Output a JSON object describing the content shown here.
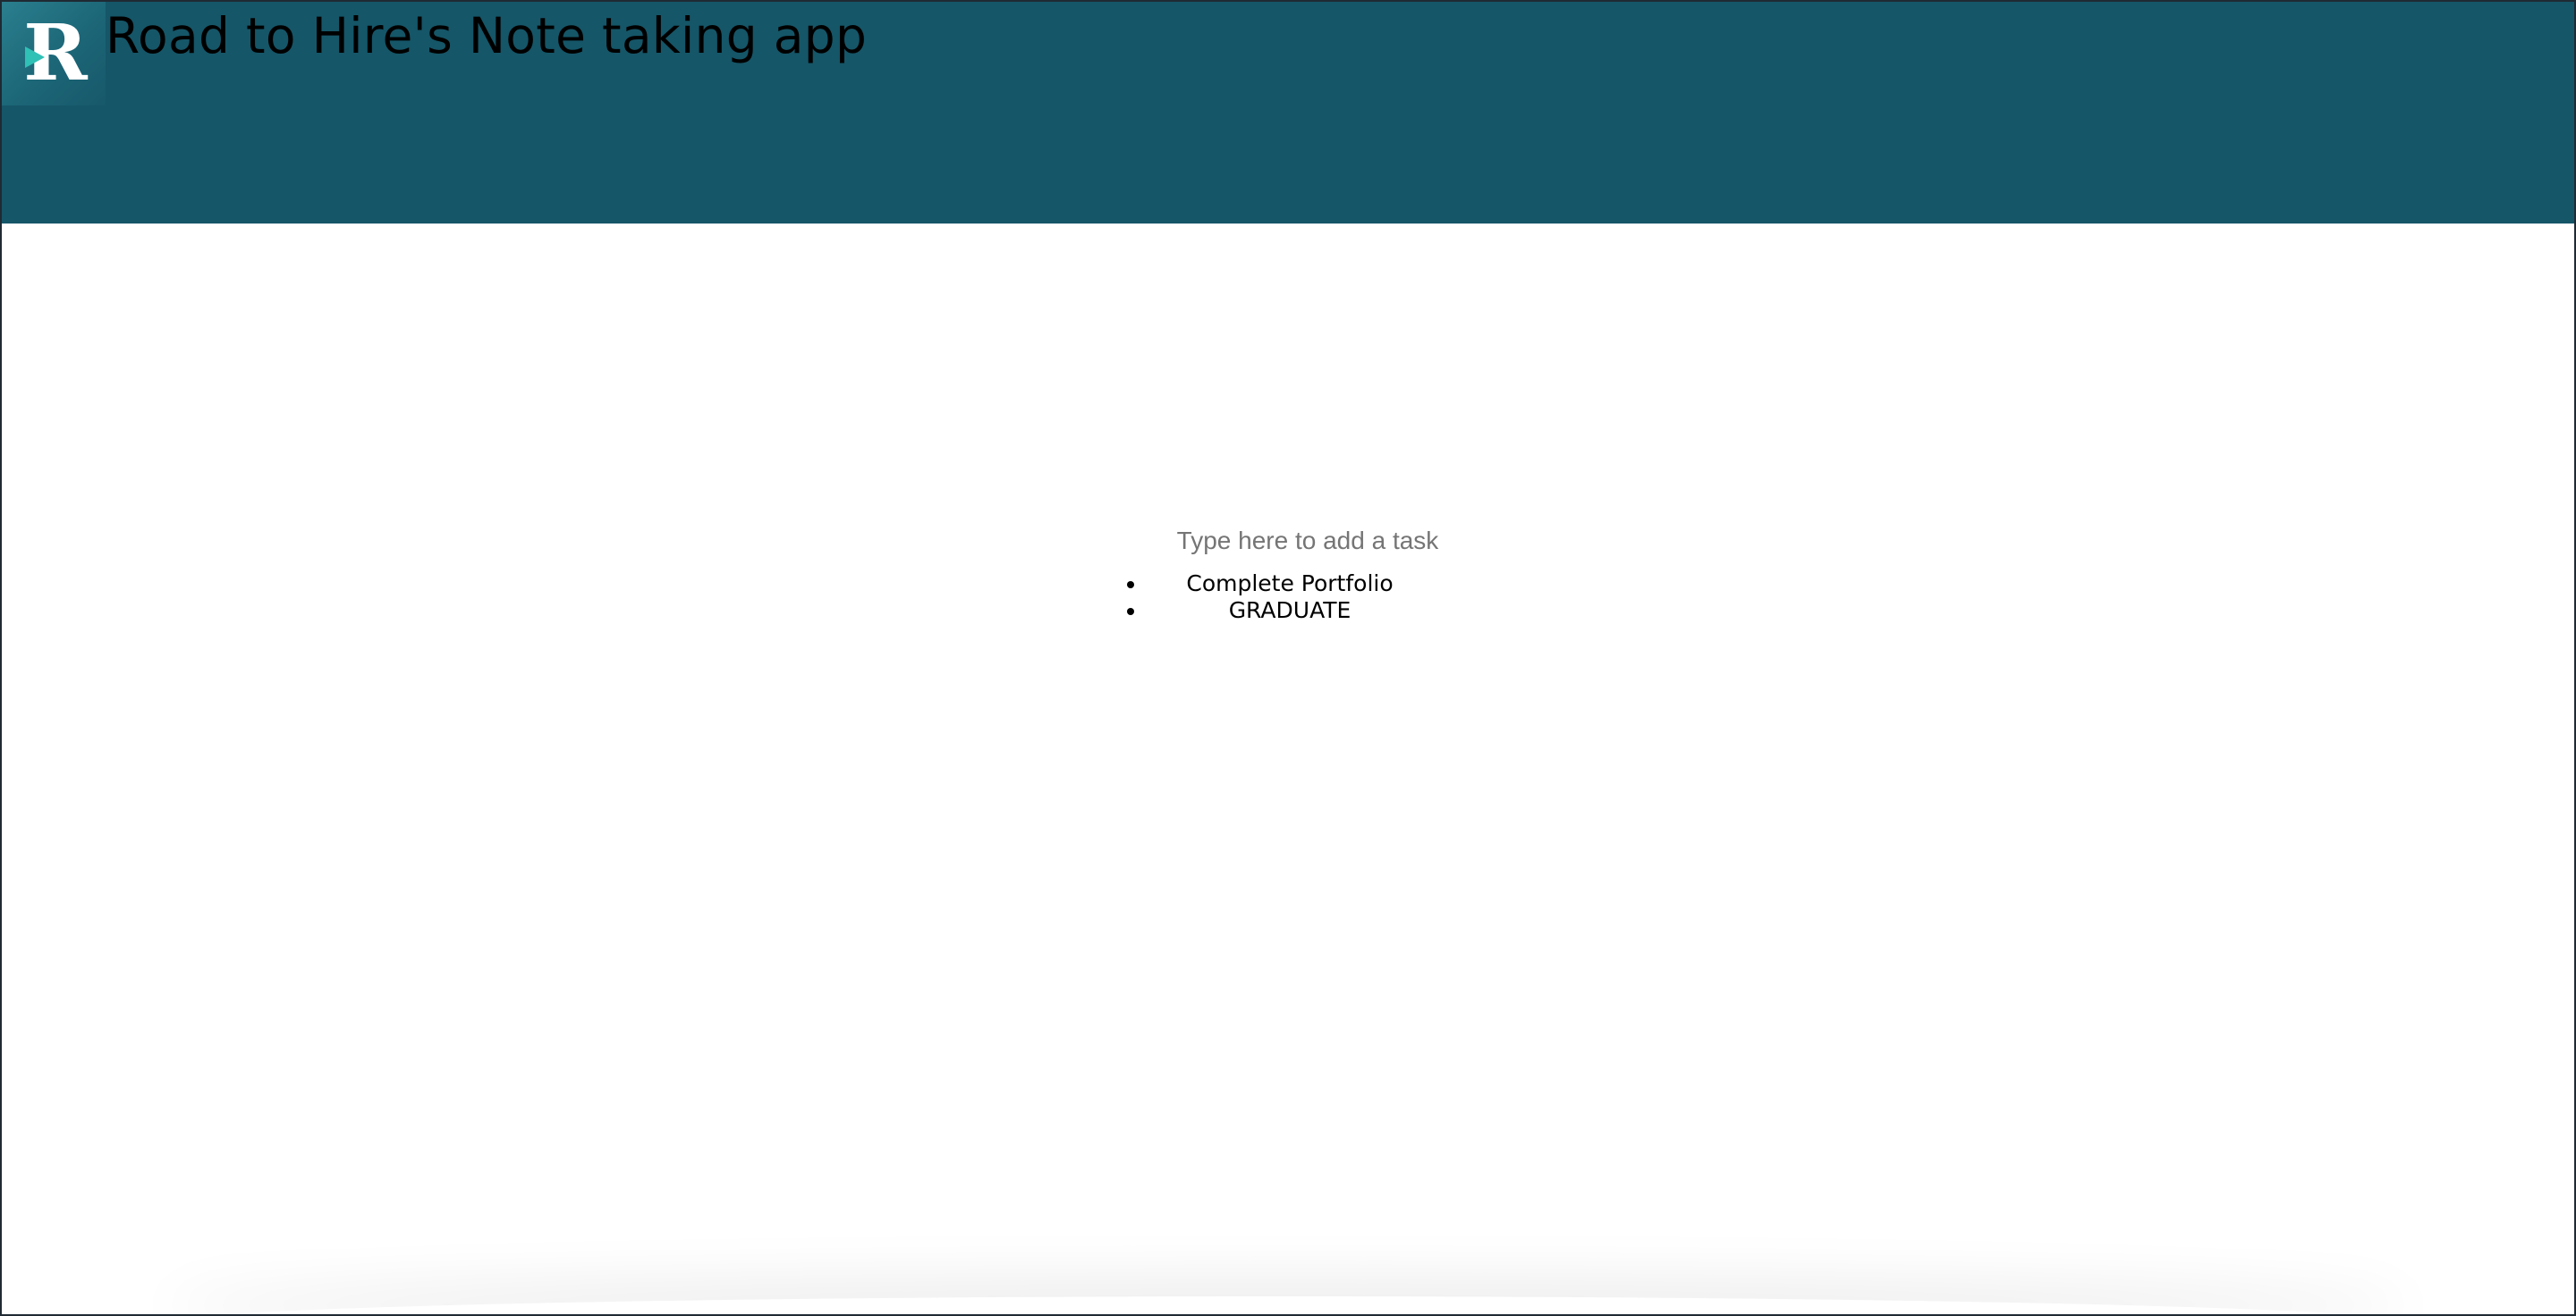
{
  "header": {
    "logo_letter": "R",
    "title": "Road to Hire's Note taking app",
    "background_color": "#155668"
  },
  "task_input": {
    "placeholder": "Type here to add a task",
    "value": ""
  },
  "tasks": [
    {
      "label": "Complete Portfolio"
    },
    {
      "label": "GRADUATE"
    }
  ]
}
